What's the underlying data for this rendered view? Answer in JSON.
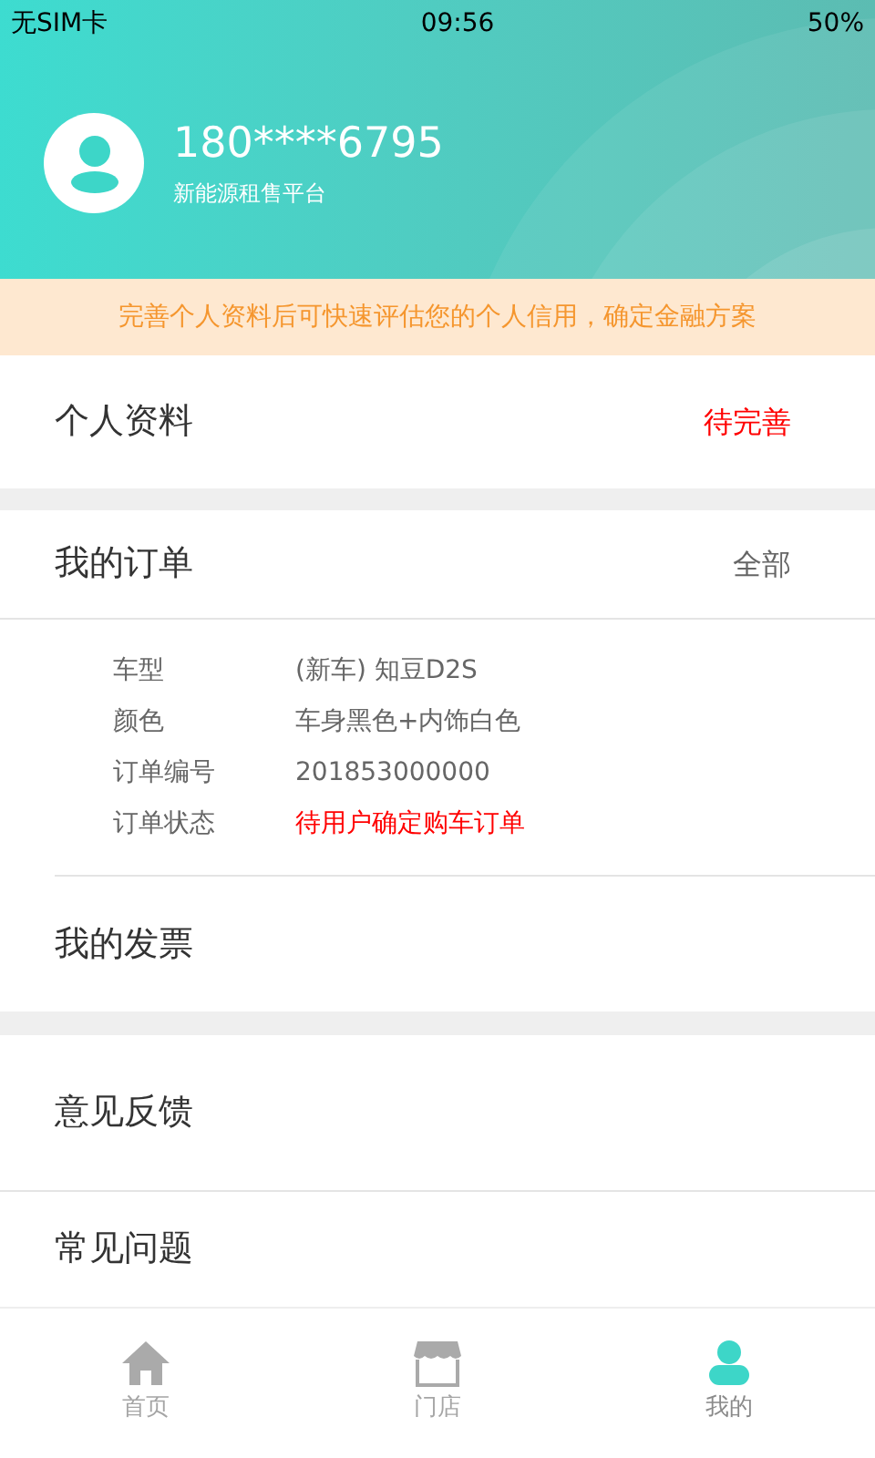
{
  "status_bar": {
    "carrier": "无SIM卡",
    "time": "09:56",
    "battery": "50%"
  },
  "profile": {
    "phone": "180****6795",
    "subtitle": "新能源租售平台"
  },
  "notice": "完善个人资料后可快速评估您的个人信用，确定金融方案",
  "personal_info": {
    "label": "个人资料",
    "status": "待完善"
  },
  "orders": {
    "title": "我的订单",
    "link": "全部",
    "details": [
      {
        "label": "车型",
        "value": "(新车) 知豆D2S",
        "kind": "normal"
      },
      {
        "label": "颜色",
        "value": "车身黑色+内饰白色",
        "kind": "normal"
      },
      {
        "label": "订单编号",
        "value": "201853000000",
        "kind": "normal"
      },
      {
        "label": "订单状态",
        "value": "待用户确定购车订单",
        "kind": "alert"
      }
    ]
  },
  "invoice": "我的发票",
  "menu": [
    "意见反馈",
    "常见问题"
  ],
  "tabs": [
    {
      "label": "首页",
      "kind": "home",
      "selected": false
    },
    {
      "label": "门店",
      "kind": "store",
      "selected": false
    },
    {
      "label": "我的",
      "kind": "user",
      "selected": true
    }
  ]
}
